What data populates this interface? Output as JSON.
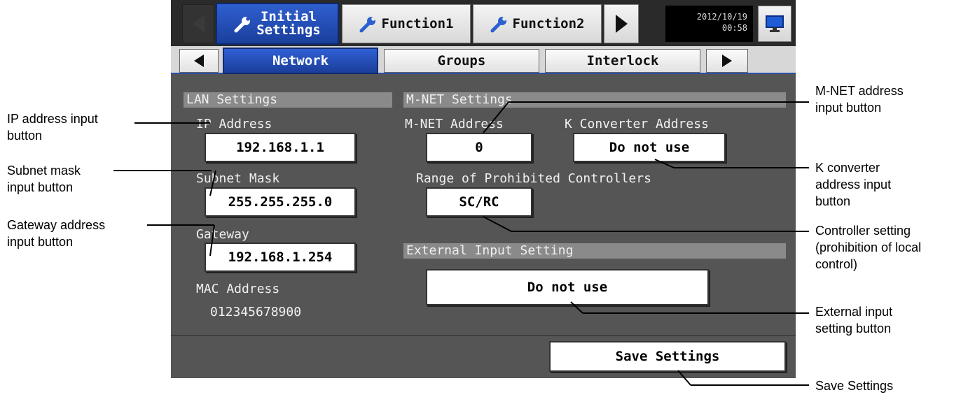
{
  "top_tabs": [
    {
      "label_line1": "Initial",
      "label_line2": "Settings",
      "active": true
    },
    {
      "label": "Function1",
      "active": false
    },
    {
      "label": "Function2",
      "active": false
    }
  ],
  "datetime": {
    "date": "2012/10/19",
    "time": "00:58"
  },
  "sub_tabs": [
    {
      "label": "Network",
      "active": true
    },
    {
      "label": "Groups",
      "active": false
    },
    {
      "label": "Interlock",
      "active": false
    }
  ],
  "lan": {
    "header": "LAN Settings",
    "ip_label": "IP Address",
    "ip_value": "192.168.1.1",
    "subnet_label": "Subnet Mask",
    "subnet_value": "255.255.255.0",
    "gateway_label": "Gateway",
    "gateway_value": "192.168.1.254",
    "mac_label": "MAC Address",
    "mac_value": "012345678900"
  },
  "mnet": {
    "header": "M-NET Settings",
    "address_label": "M-NET Address",
    "address_value": "0",
    "kconv_label": "K Converter Address",
    "kconv_value": "Do not use",
    "range_label": "Range of Prohibited Controllers",
    "range_value": "SC/RC"
  },
  "external": {
    "header": "External Input Setting",
    "value": "Do not use"
  },
  "save_label": "Save Settings",
  "annotations": {
    "ip": [
      "IP address input",
      "button"
    ],
    "subnet": [
      "Subnet mask",
      "input button"
    ],
    "gateway": [
      "Gateway address",
      "input button"
    ],
    "mnet": [
      "M-NET address",
      "input button"
    ],
    "kconv": [
      "K converter",
      "address input",
      "button"
    ],
    "controller": [
      "Controller setting",
      "(prohibition of local",
      "control)"
    ],
    "external": [
      "External input",
      "setting button"
    ],
    "save": [
      "Save Settings"
    ]
  }
}
